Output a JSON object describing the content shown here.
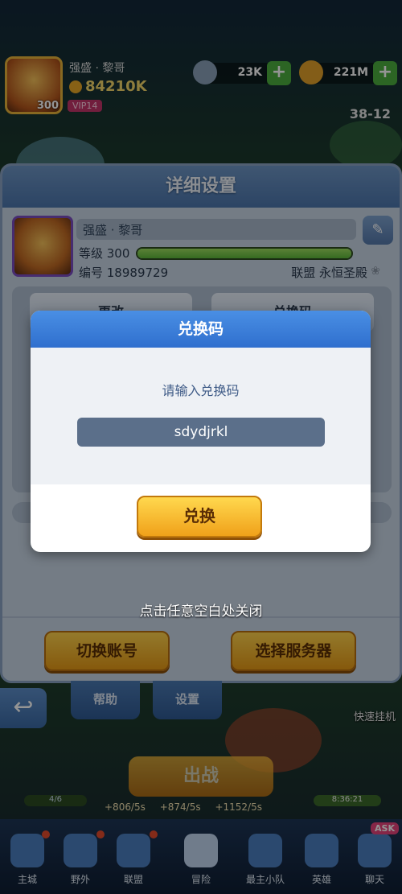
{
  "player": {
    "level": "300",
    "name": "强盛 · 黎哥",
    "power": "84210K",
    "vip": "VIP14",
    "res_diamond": "23K",
    "res_gold": "221M",
    "stage": "38-12"
  },
  "panel": {
    "title": "详细设置",
    "name": "强盛 · 黎哥",
    "level_label": "等级 300",
    "exp_fraction": 1.0,
    "id_label": "编号 18989729",
    "guild_label": "联盟 永恒圣殿",
    "btn_rename": "更改",
    "btn_redeem_tab": "兑换码",
    "btn_switch_account": "切换账号",
    "btn_select_server": "选择服务器"
  },
  "dialog": {
    "title": "兑换码",
    "prompt": "请输入兑换码",
    "code_value": "sdydjrkl",
    "confirm": "兑换"
  },
  "close_hint": "点击任意空白处关闭",
  "hud": {
    "tab_help": "帮助",
    "tab_settings": "设置",
    "quick_idle": "快速挂机",
    "battle": "出战",
    "progress_left": "4/6",
    "progress_right": "8:36:21",
    "rate1": "+806/5s",
    "rate2": "+874/5s",
    "rate3": "+1152/5s",
    "ask": "ASK"
  },
  "nav": {
    "items": [
      "主城",
      "野外",
      "联盟",
      "冒险",
      "最主小队",
      "英雄",
      "聊天"
    ]
  },
  "colors": {
    "accent_blue": "#2f6fce",
    "accent_yellow": "#f0a11a",
    "panel_bg": "#c9d6e5"
  }
}
